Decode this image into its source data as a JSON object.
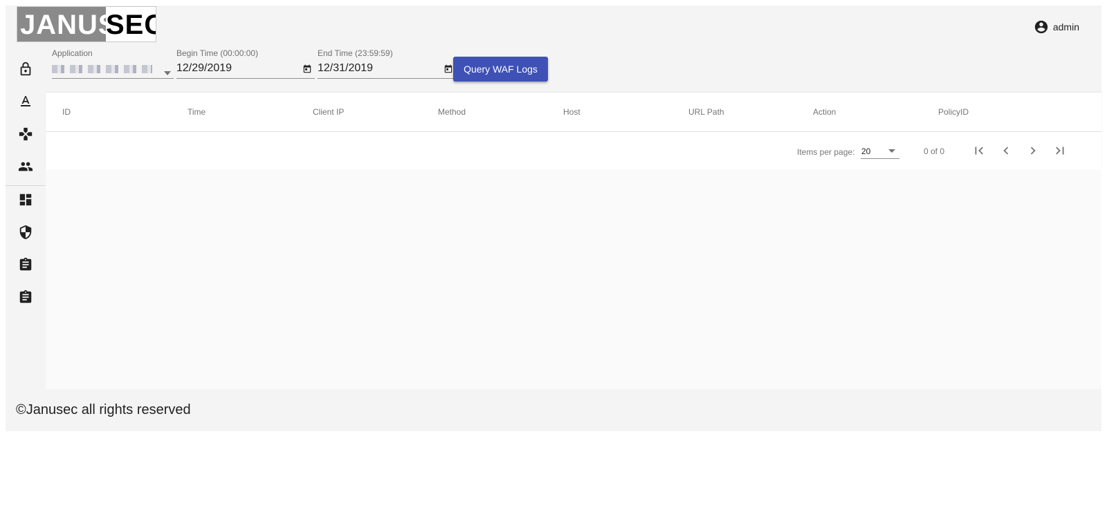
{
  "header": {
    "logo_left": "JANUS",
    "logo_right": "SEC",
    "user": "admin"
  },
  "sidebar": {
    "items": [
      {
        "icon": "lock-icon"
      },
      {
        "icon": "text-format-icon"
      },
      {
        "icon": "gamepad-icon"
      },
      {
        "icon": "people-icon"
      },
      {
        "icon": "dashboard-icon"
      },
      {
        "icon": "security-shield-icon"
      },
      {
        "icon": "assignment-icon"
      },
      {
        "icon": "assignment-icon"
      }
    ]
  },
  "filter": {
    "application_label": "Application",
    "begin_label": "Begin Time (00:00:00)",
    "begin_value": "12/29/2019",
    "end_label": "End Time (23:59:59)",
    "end_value": "12/31/2019",
    "query_button": "Query WAF Logs"
  },
  "table": {
    "columns": [
      "ID",
      "Time",
      "Client IP",
      "Method",
      "Host",
      "URL Path",
      "Action",
      "PolicyID"
    ]
  },
  "paginator": {
    "items_per_page_label": "Items per page:",
    "page_size": "20",
    "range": "0 of 0"
  },
  "footer": {
    "copyright": "©Janusec all rights reserved"
  },
  "colors": {
    "primary": "#3f51b5",
    "background": "#f4f4f4",
    "content": "#fafafa"
  }
}
